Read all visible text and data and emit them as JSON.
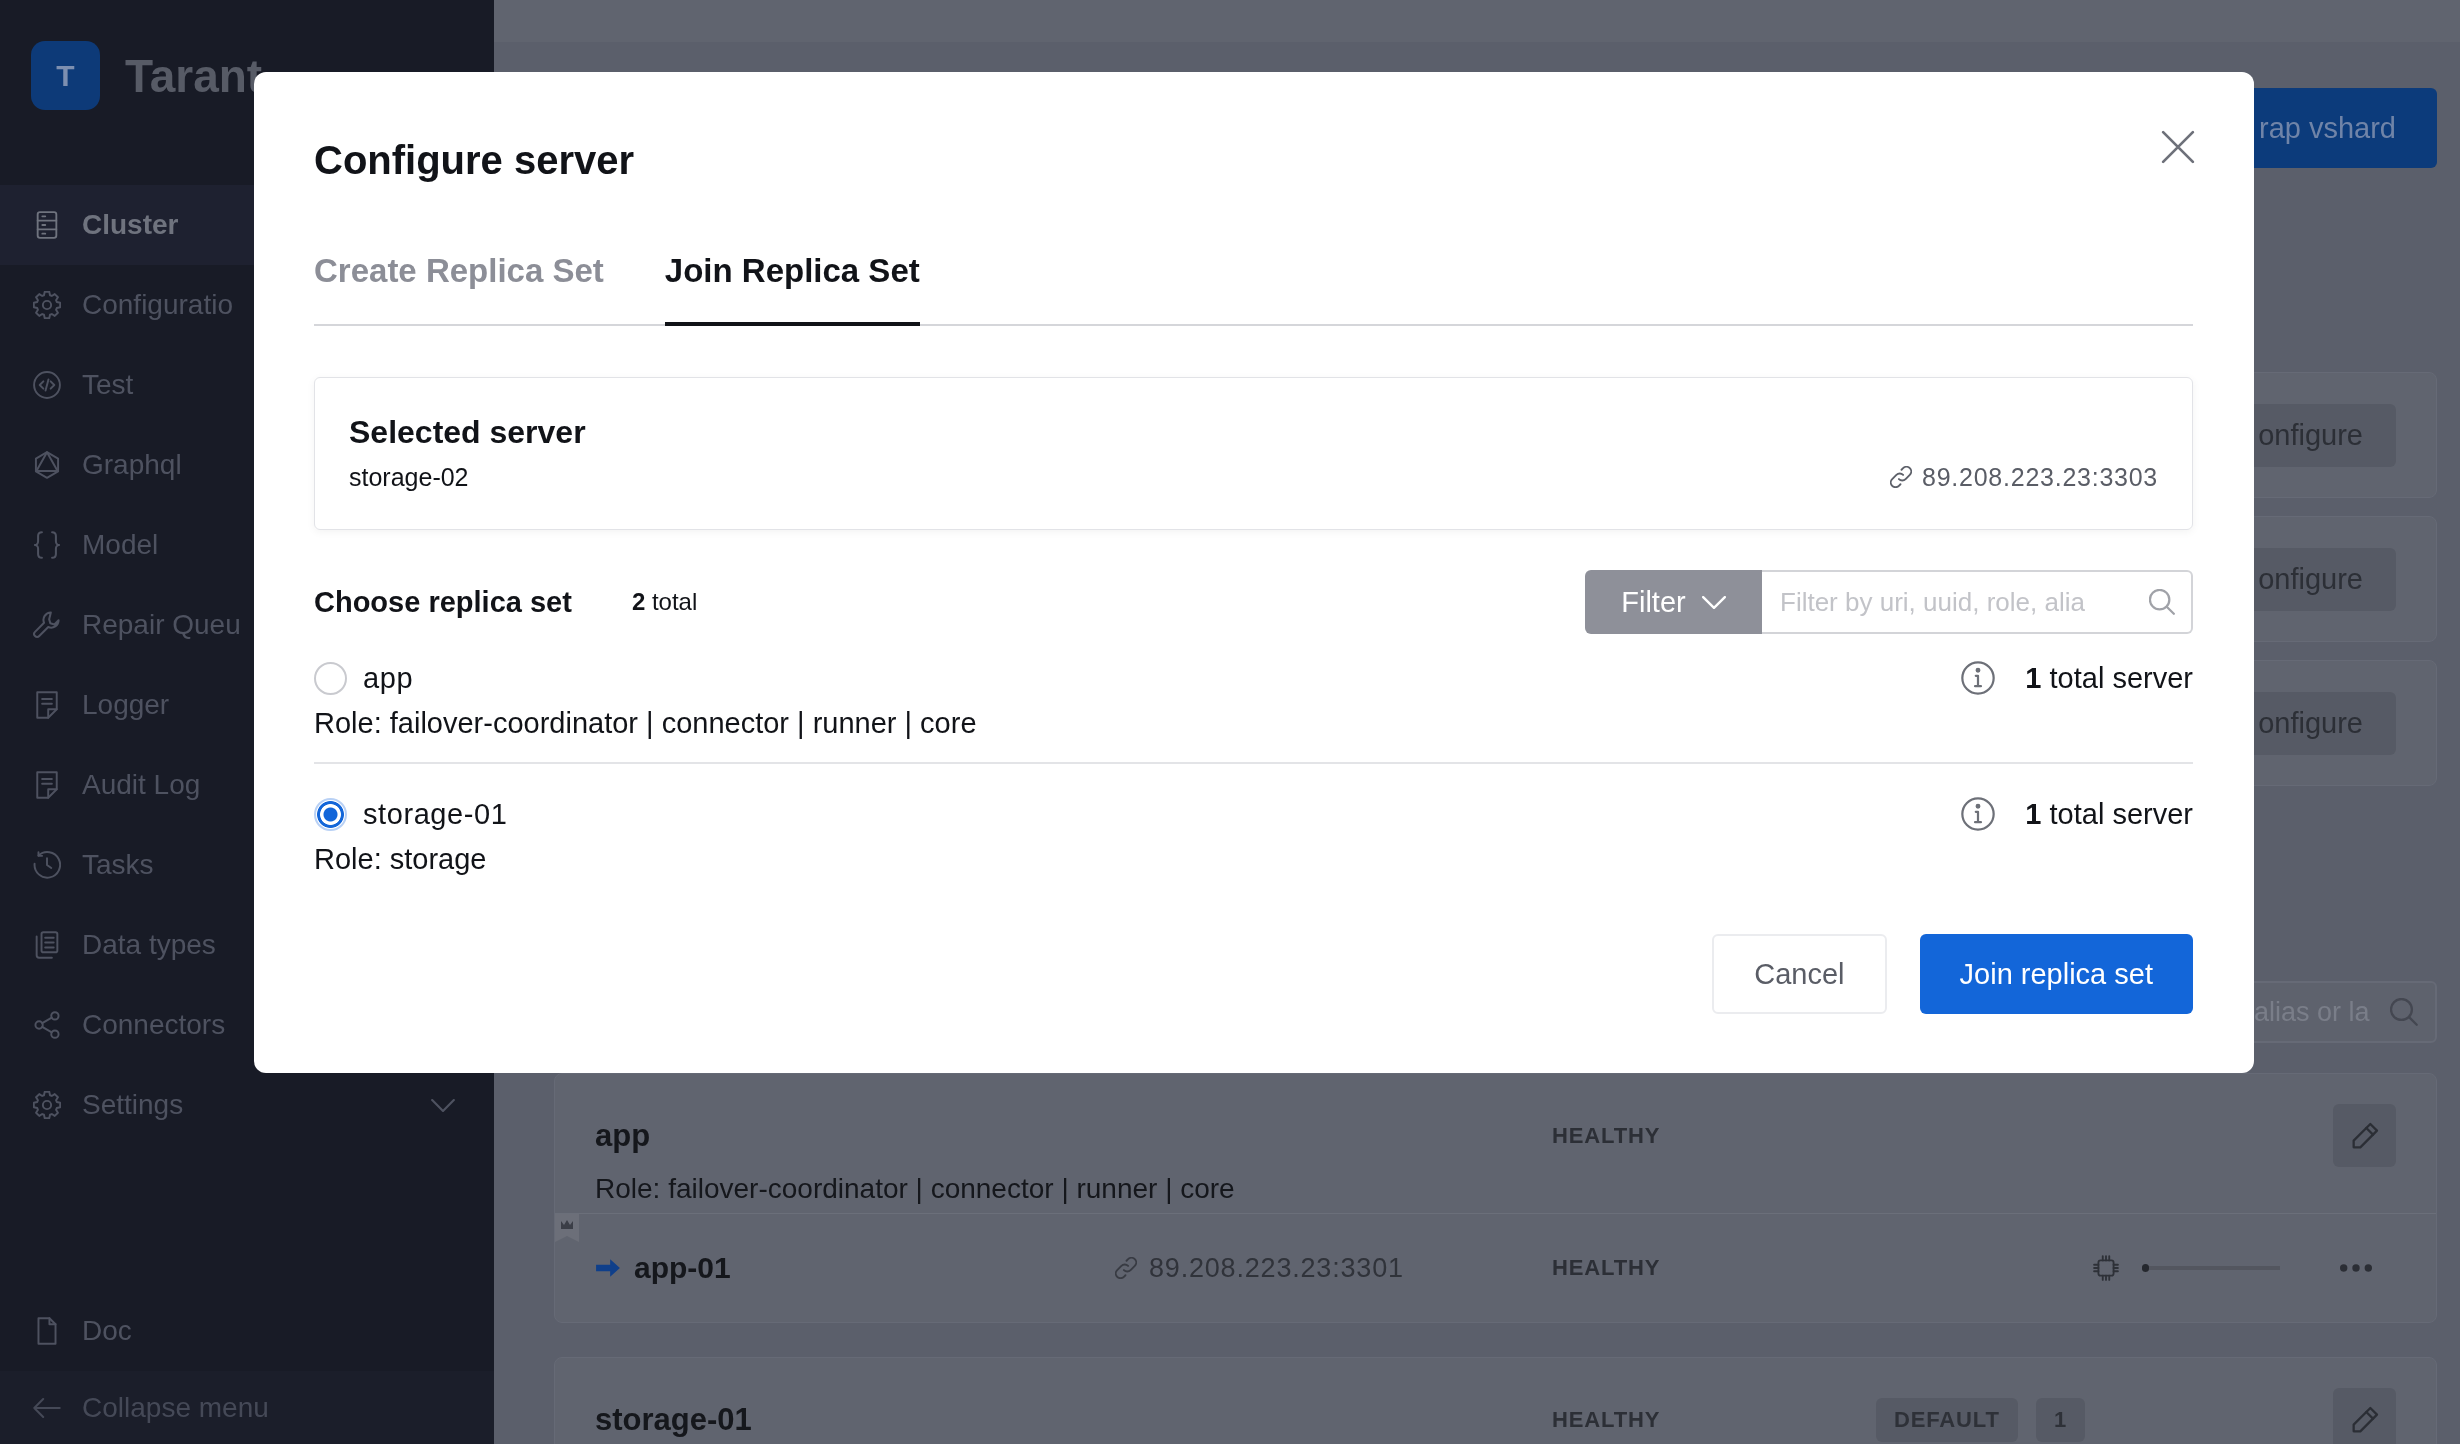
{
  "sidebar": {
    "logo": {
      "letter": "T",
      "text": "Tarant"
    },
    "items": [
      {
        "label": "Cluster",
        "kind": "link",
        "selected": true
      },
      {
        "label": "Configuratio",
        "kind": "link",
        "selected": false
      },
      {
        "label": "Test",
        "kind": "link",
        "selected": false
      },
      {
        "label": "Graphql",
        "kind": "link",
        "selected": false
      },
      {
        "label": "Model",
        "kind": "link",
        "selected": false
      },
      {
        "label": "Repair Queu",
        "kind": "link",
        "selected": false
      },
      {
        "label": "Logger",
        "kind": "link",
        "selected": false
      },
      {
        "label": "Audit Log",
        "kind": "link",
        "selected": false
      },
      {
        "label": "Tasks",
        "kind": "link",
        "selected": false
      },
      {
        "label": "Data types",
        "kind": "link",
        "selected": false
      },
      {
        "label": "Connectors",
        "kind": "link",
        "selected": false
      },
      {
        "label": "Settings",
        "kind": "group",
        "selected": false,
        "expanded": false
      }
    ],
    "footer": [
      {
        "label": "Doc"
      },
      {
        "label": "Collapse menu"
      }
    ]
  },
  "page": {
    "toolbar_button": "rap vshard",
    "server_cards": [
      {
        "button": "onfigure"
      },
      {
        "button": "onfigure"
      },
      {
        "button": "onfigure"
      }
    ],
    "search": {
      "placeholder": "alias or la"
    },
    "replica_sets": [
      {
        "name": "app",
        "status": "HEALTHY",
        "roles": "Role: failover-coordinator | connector | runner | core",
        "servers": [
          {
            "name": "app-01",
            "uri": "89.208.223.23:3301",
            "status": "HEALTHY",
            "leader": true,
            "current": true,
            "level": 0.05
          }
        ]
      },
      {
        "name": "storage-01",
        "status": "HEALTHY",
        "badges": [
          "DEFAULT",
          "1"
        ]
      }
    ]
  },
  "modal": {
    "title": "Configure server",
    "tabs": [
      {
        "label": "Create Replica Set",
        "selected": false
      },
      {
        "label": "Join Replica Set",
        "selected": true
      }
    ],
    "selected_server": {
      "title": "Selected server",
      "name": "storage-02",
      "uri": "89.208.223.23:3303"
    },
    "replica_list": {
      "title": "Choose replica set",
      "count": "**2** total",
      "filter_button": "Filter",
      "search": {
        "placeholder": "Filter by uri, uuid, role, alia"
      },
      "items": [
        {
          "name": "app",
          "roles": "Role: failover-coordinator | connector | runner | core",
          "server_count": "**1** total server",
          "selected": false
        },
        {
          "name": "storage-01",
          "roles": "Role: storage",
          "server_count": "**1** total server",
          "selected": true
        }
      ]
    },
    "buttons": [
      {
        "label": "Cancel",
        "kind": "secondary"
      },
      {
        "label": "Join replica set",
        "kind": "primary"
      }
    ]
  }
}
